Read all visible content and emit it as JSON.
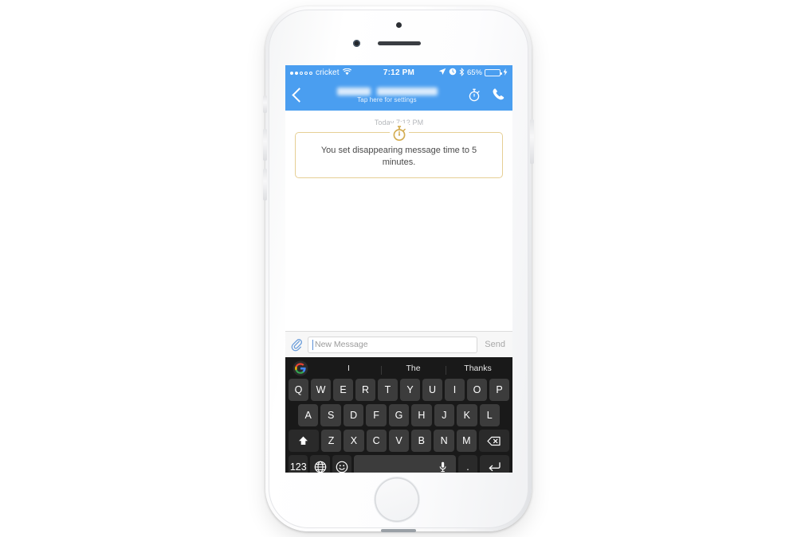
{
  "device": {
    "name": "iPhone",
    "color": "silver-white",
    "home_button": "home-button"
  },
  "status_bar": {
    "carrier": "cricket",
    "signal_dots_total": 5,
    "signal_dots_filled": 2,
    "wifi_icon": "wifi-icon",
    "time": "7:12 PM",
    "location_icon": "location-arrow-icon",
    "alarm_icon": "alarm-clock-icon",
    "bluetooth_icon": "bluetooth-icon",
    "battery_percent": "65%",
    "battery_level": 65,
    "charging_icon": "lightning-bolt-icon",
    "background_color": "#4a9ef0",
    "text_color": "#ffffff"
  },
  "nav_bar": {
    "back_icon": "back-chevron-icon",
    "contact_name": "",
    "contact_name_redacted": true,
    "subtitle": "Tap here for settings",
    "timer_icon": "stopwatch-icon",
    "call_icon": "phone-handset-icon",
    "background_color": "#4a9ef0"
  },
  "conversation": {
    "day_stamp": "Today 7:12 PM",
    "event_icon": "stopwatch-icon",
    "event_message": "You set disappearing message time to 5 minutes.",
    "event_border_color": "#e6cf94",
    "event_icon_color": "#d4ad52"
  },
  "compose_bar": {
    "attach_icon": "paperclip-icon",
    "input_value": "",
    "placeholder": "New Message",
    "send_label": "Send"
  },
  "keyboard": {
    "logo_icon": "google-g-icon",
    "suggestions": [
      "I",
      "The",
      "Thanks"
    ],
    "row1": [
      "Q",
      "W",
      "E",
      "R",
      "T",
      "Y",
      "U",
      "I",
      "O",
      "P"
    ],
    "row2": [
      "A",
      "S",
      "D",
      "F",
      "G",
      "H",
      "J",
      "K",
      "L"
    ],
    "row3_letters": [
      "Z",
      "X",
      "C",
      "V",
      "B",
      "N",
      "M"
    ],
    "shift_icon": "shift-arrow-icon",
    "backspace_icon": "backspace-icon",
    "numeric_label": "123",
    "globe_icon": "globe-icon",
    "emoji_icon": "emoji-smiley-icon",
    "space_label": "",
    "mic_icon": "microphone-icon",
    "period_label": ".",
    "enter_icon": "enter-return-icon",
    "background_color": "#191919",
    "key_color": "#3c3c3c"
  }
}
